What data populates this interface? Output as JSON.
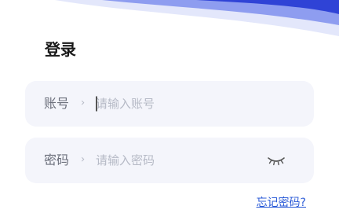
{
  "login": {
    "title": "登录",
    "account": {
      "label": "账号",
      "separator": "›",
      "placeholder": "请输入账号"
    },
    "password": {
      "label": "密码",
      "separator": "›",
      "placeholder": "请输入密码",
      "toggle_icon": "eye-closed-icon"
    },
    "forgot_link": "忘记密码?"
  },
  "colors": {
    "accent": "#2b5bd7",
    "field_bg": "#f4f5fb",
    "deco_dark": "#2f43d6",
    "deco_light": "#c9cff5"
  }
}
